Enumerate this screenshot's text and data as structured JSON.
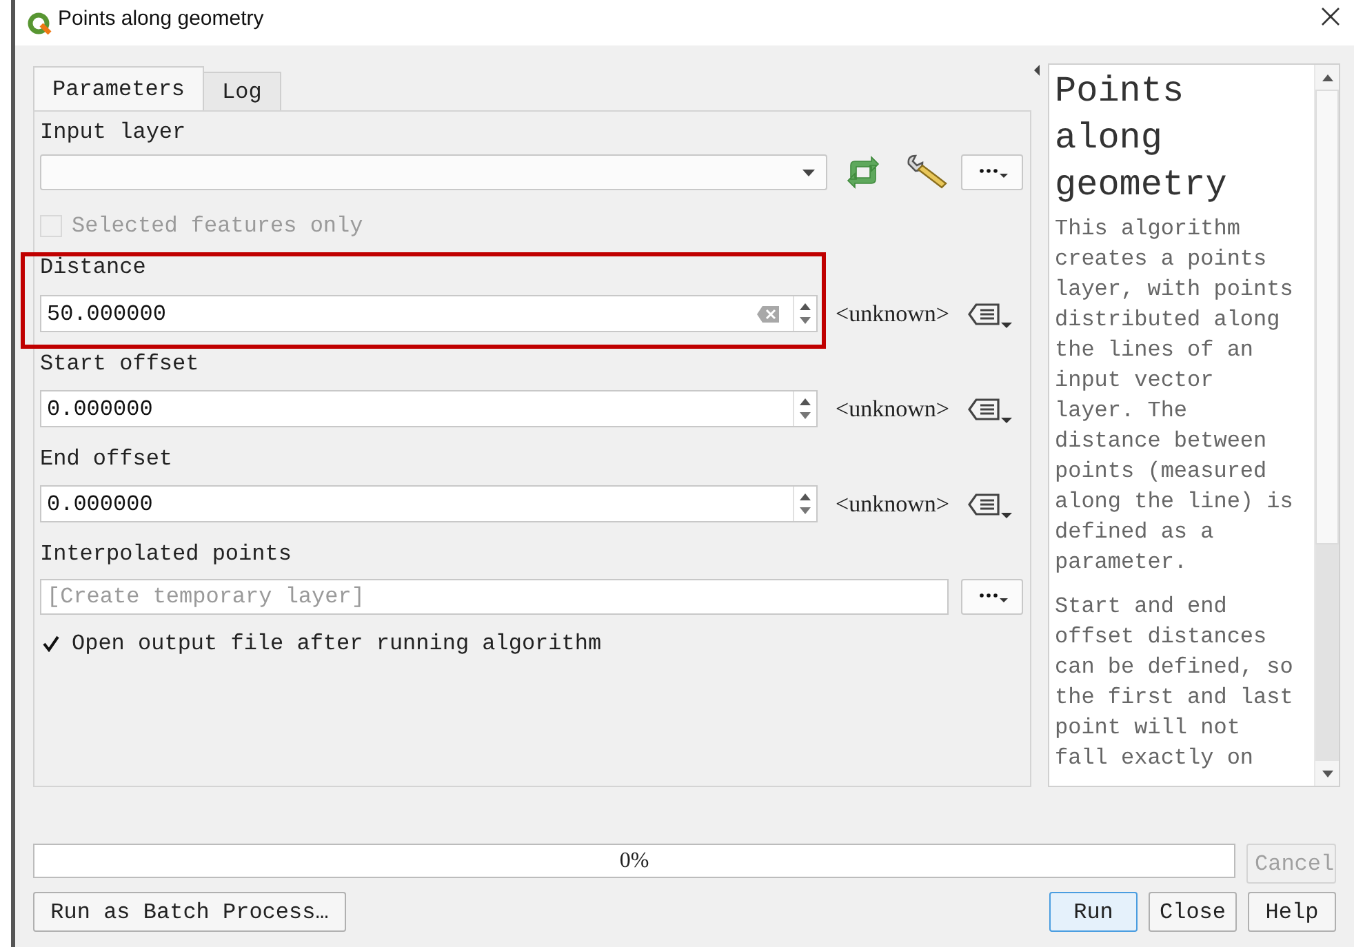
{
  "window": {
    "title": "Points along geometry"
  },
  "tabs": [
    {
      "label": "Parameters",
      "selected": true
    },
    {
      "label": "Log",
      "selected": false
    }
  ],
  "parameters": [
    {
      "kind": "layer",
      "label": "Input layer"
    },
    {
      "kind": "checkbox",
      "label": "Selected features only",
      "checked": false,
      "disabled": true
    },
    {
      "kind": "number",
      "label": "Distance",
      "value": "50.000000",
      "clearable": true,
      "unit": "<unknown>",
      "highlighted": true
    },
    {
      "kind": "number",
      "label": "Start offset",
      "value": "0.000000",
      "clearable": false,
      "unit": "<unknown>",
      "highlighted": false
    },
    {
      "kind": "number",
      "label": "End offset",
      "value": "0.000000",
      "clearable": false,
      "unit": "<unknown>",
      "highlighted": false
    },
    {
      "kind": "destination",
      "label": "Interpolated points",
      "placeholder": "[Create temporary layer]"
    },
    {
      "kind": "checkbox",
      "label": "Open output file after running algorithm",
      "checked": true,
      "disabled": false
    }
  ],
  "help": {
    "title": "Points along geometry",
    "paragraphs": [
      "This algorithm creates a points layer, with points distributed along the lines of an input vector layer. The distance between points (measured along the line) is defined as a parameter.",
      "Start and end offset distances can be defined, so the first and last point will not fall exactly on"
    ]
  },
  "progress": {
    "label": "0%",
    "level": 0
  },
  "buttons": [
    {
      "label": "Cancel",
      "disabled": true,
      "default": false
    },
    {
      "label": "Run as Batch Process…",
      "disabled": false,
      "default": false
    },
    {
      "label": "Run",
      "disabled": false,
      "default": true
    },
    {
      "label": "Close",
      "disabled": false,
      "default": false
    },
    {
      "label": "Help",
      "disabled": false,
      "default": false
    }
  ]
}
